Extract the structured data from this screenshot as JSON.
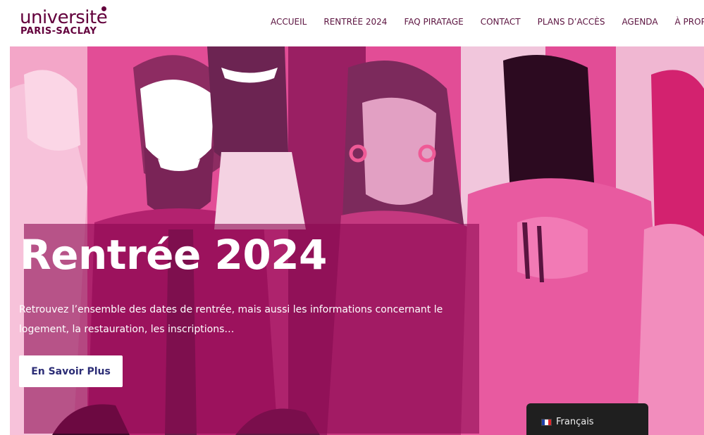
{
  "header": {
    "logo": {
      "top_text": "universite",
      "bottom_text": "PARIS-SACLAY"
    },
    "nav": [
      {
        "label": "ACCUEIL"
      },
      {
        "label": "RENTRÉE 2024"
      },
      {
        "label": "FAQ PIRATAGE"
      },
      {
        "label": "CONTACT"
      },
      {
        "label": "PLANS D’ACCÈS"
      },
      {
        "label": "AGENDA"
      },
      {
        "label": "À PROPOS"
      }
    ]
  },
  "hero": {
    "title": "Rentrée 2024",
    "description": "Retrouvez l’ensemble des dates de rentrée, mais aussi les informations concernant le logement, la restauration, les inscriptions…",
    "button_label": "En Savoir Plus"
  },
  "language_switcher": {
    "label": "Français",
    "flag_icon": "france-flag-icon"
  },
  "colors": {
    "brand": "#63003c",
    "nav_text": "#5c1440",
    "button_text": "#2c2d76",
    "overlay": "#8c0852"
  }
}
